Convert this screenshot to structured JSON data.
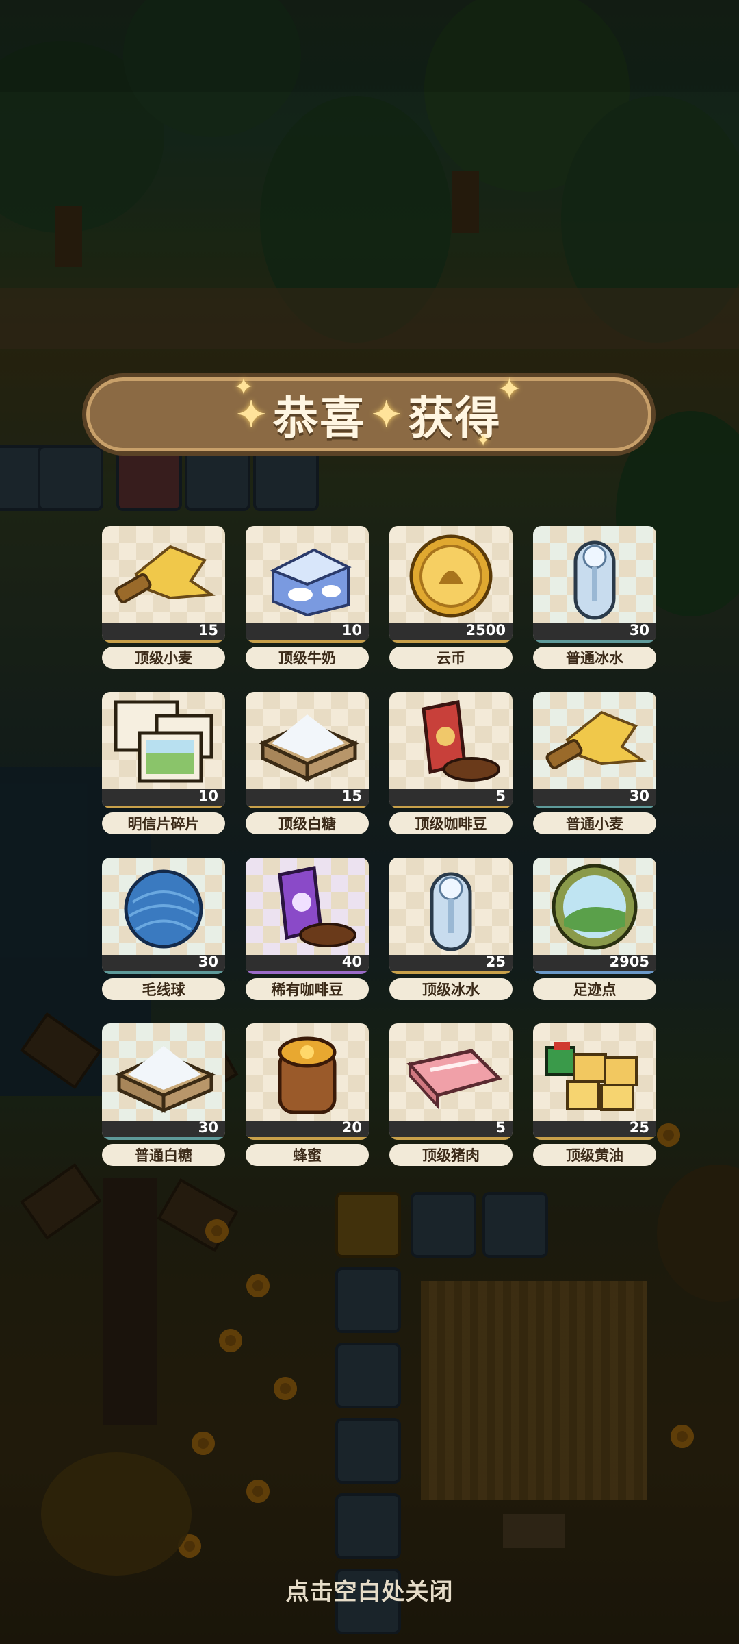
{
  "banner": {
    "title_part1": "恭喜",
    "title_part2": "获得"
  },
  "colors": {
    "banner_bg": "#8b6a44",
    "label_bg": "#f2ead8",
    "count_bar": "#2f2f2f",
    "footer_text": "#e6dcc8"
  },
  "items": [
    {
      "name": "顶级小麦",
      "count": "15",
      "icon": "wheat-icon",
      "rarity": "top"
    },
    {
      "name": "顶级牛奶",
      "count": "10",
      "icon": "milk-carton-icon",
      "rarity": "top"
    },
    {
      "name": "云币",
      "count": "2500",
      "icon": "coin-icon",
      "rarity": "top"
    },
    {
      "name": "普通冰水",
      "count": "30",
      "icon": "ice-water-icon",
      "rarity": "common"
    },
    {
      "name": "明信片碎片",
      "count": "10",
      "icon": "postcard-icon",
      "rarity": "top"
    },
    {
      "name": "顶级白糖",
      "count": "15",
      "icon": "sugar-icon",
      "rarity": "top"
    },
    {
      "name": "顶级咖啡豆",
      "count": "5",
      "icon": "coffee-bag-icon",
      "rarity": "top"
    },
    {
      "name": "普通小麦",
      "count": "30",
      "icon": "wheat-icon",
      "rarity": "common"
    },
    {
      "name": "毛线球",
      "count": "30",
      "icon": "yarn-ball-icon",
      "rarity": "common"
    },
    {
      "name": "稀有咖啡豆",
      "count": "40",
      "icon": "coffee-bag-purple-icon",
      "rarity": "rare"
    },
    {
      "name": "顶级冰水",
      "count": "25",
      "icon": "ice-water-icon",
      "rarity": "top"
    },
    {
      "name": "足迹点",
      "count": "2905",
      "icon": "footprint-orb-icon",
      "rarity": "blue"
    },
    {
      "name": "普通白糖",
      "count": "30",
      "icon": "sugar-icon",
      "rarity": "common"
    },
    {
      "name": "蜂蜜",
      "count": "20",
      "icon": "honey-jar-icon",
      "rarity": "top"
    },
    {
      "name": "顶级猪肉",
      "count": "5",
      "icon": "pork-icon",
      "rarity": "top"
    },
    {
      "name": "顶级黄油",
      "count": "25",
      "icon": "butter-icon",
      "rarity": "top"
    }
  ],
  "footer": {
    "hint": "点击空白处关闭"
  }
}
